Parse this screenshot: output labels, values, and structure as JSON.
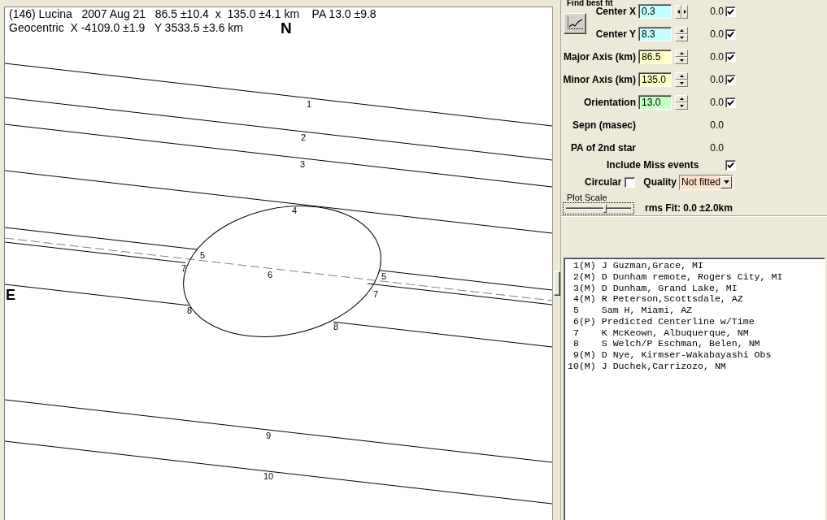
{
  "plot": {
    "title": "(146) Lucina   2007 Aug 21   86.5 ±10.4  x  135.0 ±4.1 km    PA 13.0 ±9.8",
    "subtitle": "Geocentric  X -4109.0 ±1.9   Y 3533.5 ±3.6 km",
    "north_label": "N",
    "east_label": "E",
    "chords": [
      {
        "kind": "miss",
        "labels": [
          "1"
        ]
      },
      {
        "kind": "miss",
        "labels": [
          "2"
        ]
      },
      {
        "kind": "miss",
        "labels": [
          "3"
        ]
      },
      {
        "kind": "miss",
        "labels": [
          "4"
        ]
      },
      {
        "kind": "hit",
        "labels": [
          "5",
          "5"
        ]
      },
      {
        "kind": "predicted",
        "labels": [
          "6"
        ]
      },
      {
        "kind": "hit",
        "labels": [
          "7",
          "7"
        ]
      },
      {
        "kind": "hit",
        "labels": [
          "8",
          "8"
        ]
      },
      {
        "kind": "miss",
        "labels": [
          "9"
        ]
      },
      {
        "kind": "miss",
        "labels": [
          "10"
        ]
      }
    ]
  },
  "fit_panel": {
    "heading": "Find best fit",
    "parameters": [
      {
        "label": "Center X",
        "kind": "horizontal",
        "value": "0.3",
        "color": "#c4ffff",
        "residual": "0.0",
        "fit": true
      },
      {
        "label": "Center Y",
        "kind": "vertical",
        "value": "8.3",
        "color": "#c4ffff",
        "residual": "0.0",
        "fit": true
      },
      {
        "label": "Major Axis (km)",
        "kind": "vertical",
        "value": "86.5",
        "color": "#ffffc4",
        "residual": "0.0",
        "fit": true
      },
      {
        "label": "Minor Axis (km)",
        "kind": "vertical",
        "value": "135.0",
        "color": "#ffffc4",
        "residual": "0.0",
        "fit": true
      },
      {
        "label": "Orientation",
        "kind": "vertical",
        "value": "13.0",
        "color": "#c4ffc4",
        "residual": "0.0",
        "fit": true
      }
    ],
    "readouts": [
      {
        "label": "Sepn (masec)",
        "value": "0.0"
      },
      {
        "label": "PA of 2nd star",
        "value": "0.0"
      }
    ],
    "include_miss": {
      "label": "Include Miss events",
      "checked": true
    },
    "circular": {
      "label": "Circular",
      "checked": false
    },
    "quality": {
      "label": "Quality",
      "value": "Not fitted"
    },
    "plot_scale": {
      "label": "Plot Scale",
      "level": 0.6
    },
    "rms_fit": "rms Fit: 0.0 ±2.0km"
  },
  "observers": [
    {
      "text": " 1(M) J Guzman,Grace, MI",
      "selected": false
    },
    {
      "text": " 2(M) D Dunham remote, Rogers City, MI",
      "selected": false
    },
    {
      "text": " 3(M) D Dunham, Grand Lake, MI",
      "selected": false
    },
    {
      "text": " 4(M) R Peterson,Scottsdale, AZ",
      "selected": false
    },
    {
      "text": " 5    Sam H, Miami, AZ",
      "selected": false
    },
    {
      "text": " 6(P) Predicted Centerline w/Time",
      "selected": false
    },
    {
      "text": " 7    K McKeown, Albuquerque, NM",
      "selected": false
    },
    {
      "text": " 8    S Welch/P Eschman, Belen, NM",
      "selected": false
    },
    {
      "text": " 9(M) D Nye, Kirmser-Wakabayashi Obs",
      "selected": false
    },
    {
      "text": "10(M) J Duchek,Carrizozo, NM",
      "selected": false
    }
  ]
}
